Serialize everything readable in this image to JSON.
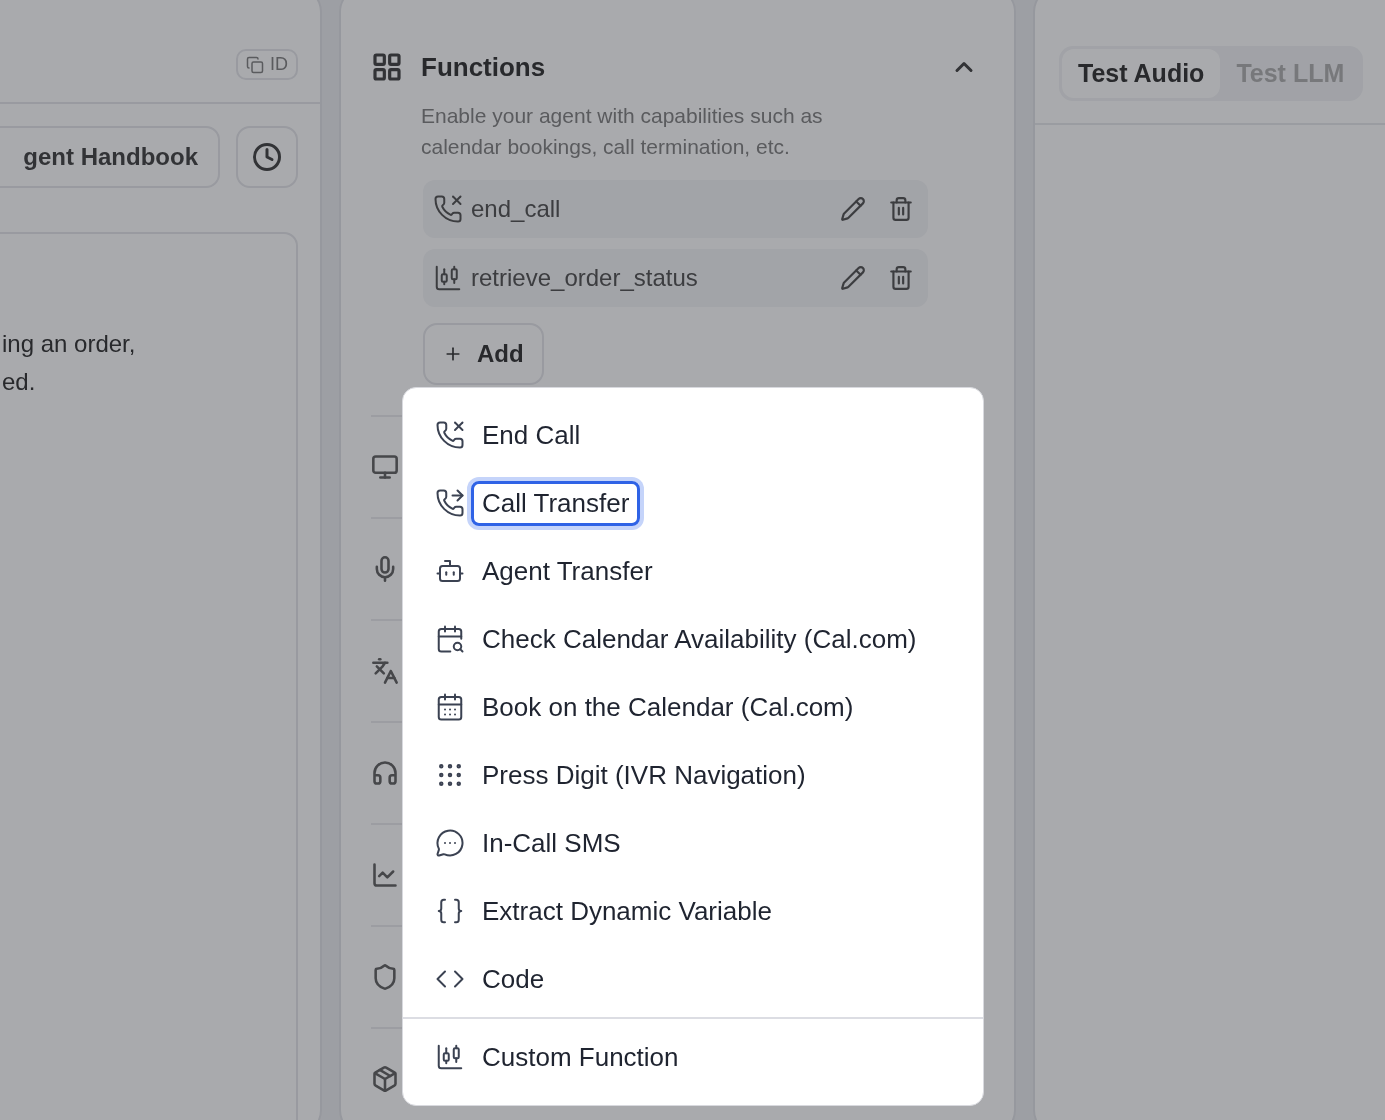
{
  "left_panel": {
    "id_chip": "ID",
    "handbook_button": "gent Handbook",
    "prompt_lines": [
      "ing an order,",
      "ed."
    ]
  },
  "functions": {
    "title": "Functions",
    "expanded": true,
    "description": "Enable your agent with capabilities such as calendar bookings, call termination, etc.",
    "items": [
      {
        "kind": "hangup",
        "name": "end_call"
      },
      {
        "kind": "custom",
        "name": "retrieve_order_status"
      }
    ],
    "add_button": "Add"
  },
  "test_tabs": [
    {
      "label": "Test Audio",
      "selected": true
    },
    {
      "label": "Test LLM",
      "selected": false
    }
  ],
  "menu": {
    "groups": [
      {
        "items": [
          {
            "kind": "hangup",
            "label": "End Call",
            "selected": false
          },
          {
            "kind": "transfer",
            "label": "Call Transfer",
            "selected": true
          },
          {
            "kind": "agent",
            "label": "Agent Transfer",
            "selected": false
          },
          {
            "kind": "availability",
            "label": "Check Calendar Availability (Cal.com)",
            "selected": false
          },
          {
            "kind": "booking",
            "label": "Book on the Calendar (Cal.com)",
            "selected": false
          },
          {
            "kind": "digits",
            "label": "Press Digit (IVR Navigation)",
            "selected": false
          },
          {
            "kind": "sms",
            "label": "In-Call SMS",
            "selected": false
          },
          {
            "kind": "variable",
            "label": "Extract Dynamic Variable",
            "selected": false
          },
          {
            "kind": "code",
            "label": "Code",
            "selected": false
          }
        ]
      },
      {
        "items": [
          {
            "kind": "custom",
            "label": "Custom Function",
            "selected": false
          }
        ]
      }
    ]
  }
}
